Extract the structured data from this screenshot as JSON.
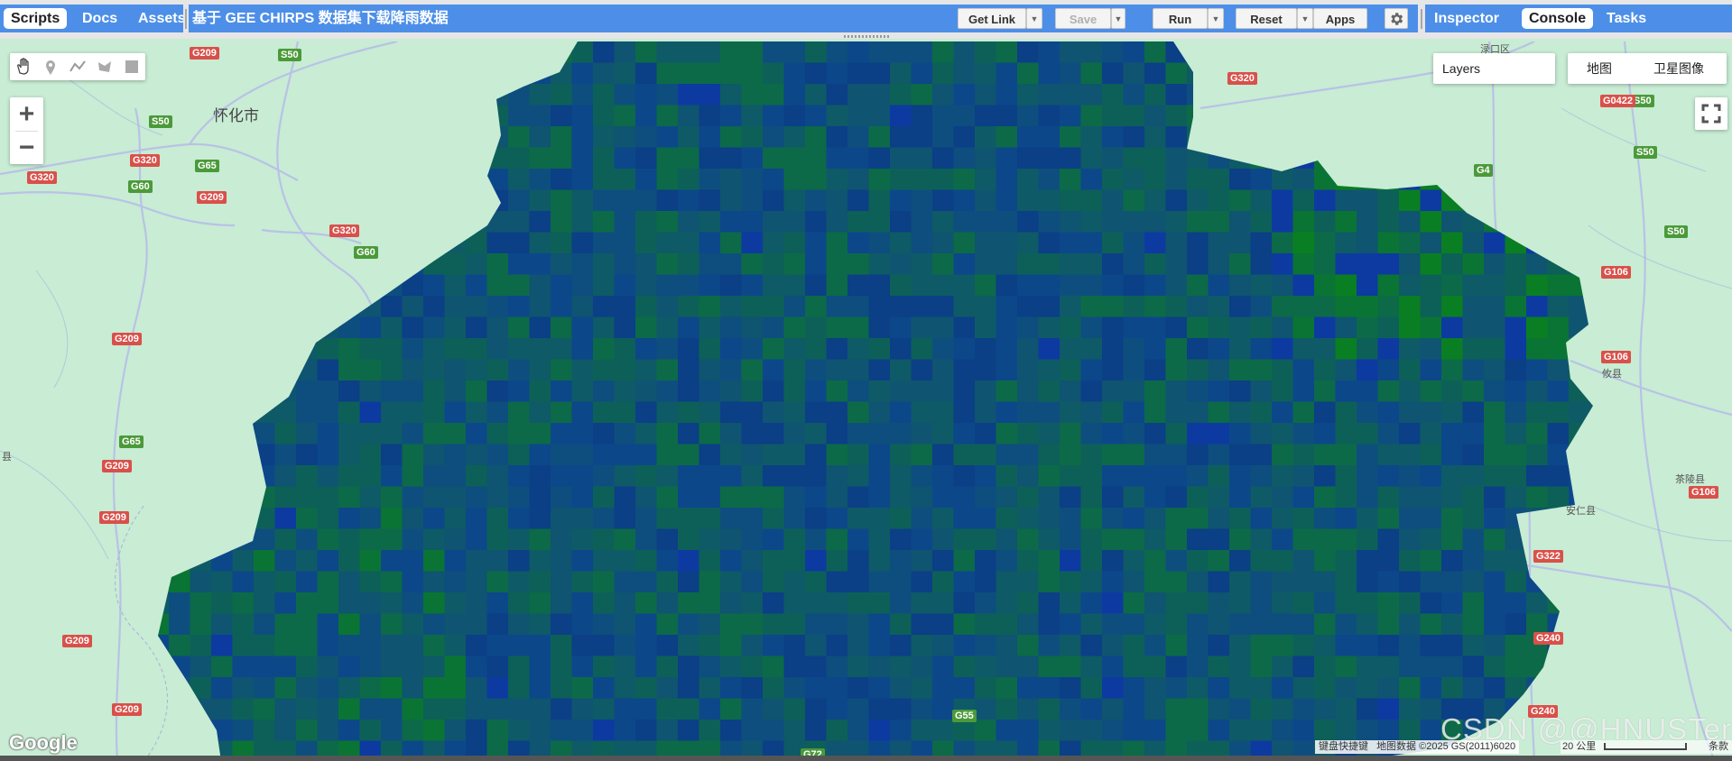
{
  "code_editor": {
    "left_tabs": [
      "Scripts",
      "Docs",
      "Assets"
    ],
    "script_title": "基于 GEE CHIRPS 数据集下载降雨数据",
    "buttons": {
      "get_link": "Get Link",
      "save": "Save",
      "run": "Run",
      "reset": "Reset",
      "apps": "Apps"
    },
    "right_tabs": [
      "Inspector",
      "Console",
      "Tasks"
    ]
  },
  "map": {
    "layers_label": "Layers",
    "map_types": [
      "地图",
      "卫星图像"
    ],
    "zoom_in": "+",
    "zoom_out": "−",
    "drawing_tools": [
      "pan-hand-icon",
      "point-marker-icon",
      "line-icon",
      "polygon-icon",
      "rectangle-icon"
    ],
    "cities": [
      "怀化市"
    ],
    "towns": [
      "攸县",
      "安仁县",
      "茶陵县",
      "渌口区",
      "县"
    ],
    "road_labels": {
      "red": [
        "G209",
        "G320",
        "G106",
        "G322",
        "G240",
        "G0422",
        "G72"
      ],
      "green": [
        "S50",
        "G65",
        "G60",
        "G4",
        "G55"
      ]
    },
    "google_logo": "Google",
    "attribution": {
      "shortcuts": "键盘快捷键",
      "map_data": "地图数据 ©2025 GS(2011)6020",
      "scale": "20 公里",
      "terms": "条款"
    },
    "watermark": "CSDN @@HNUSTer",
    "colors": {
      "panel_blue": "#4d8fe8",
      "map_base": "#c8ecd4",
      "rain_low": "#0f4a80",
      "rain_high": "#0a8e14"
    }
  }
}
